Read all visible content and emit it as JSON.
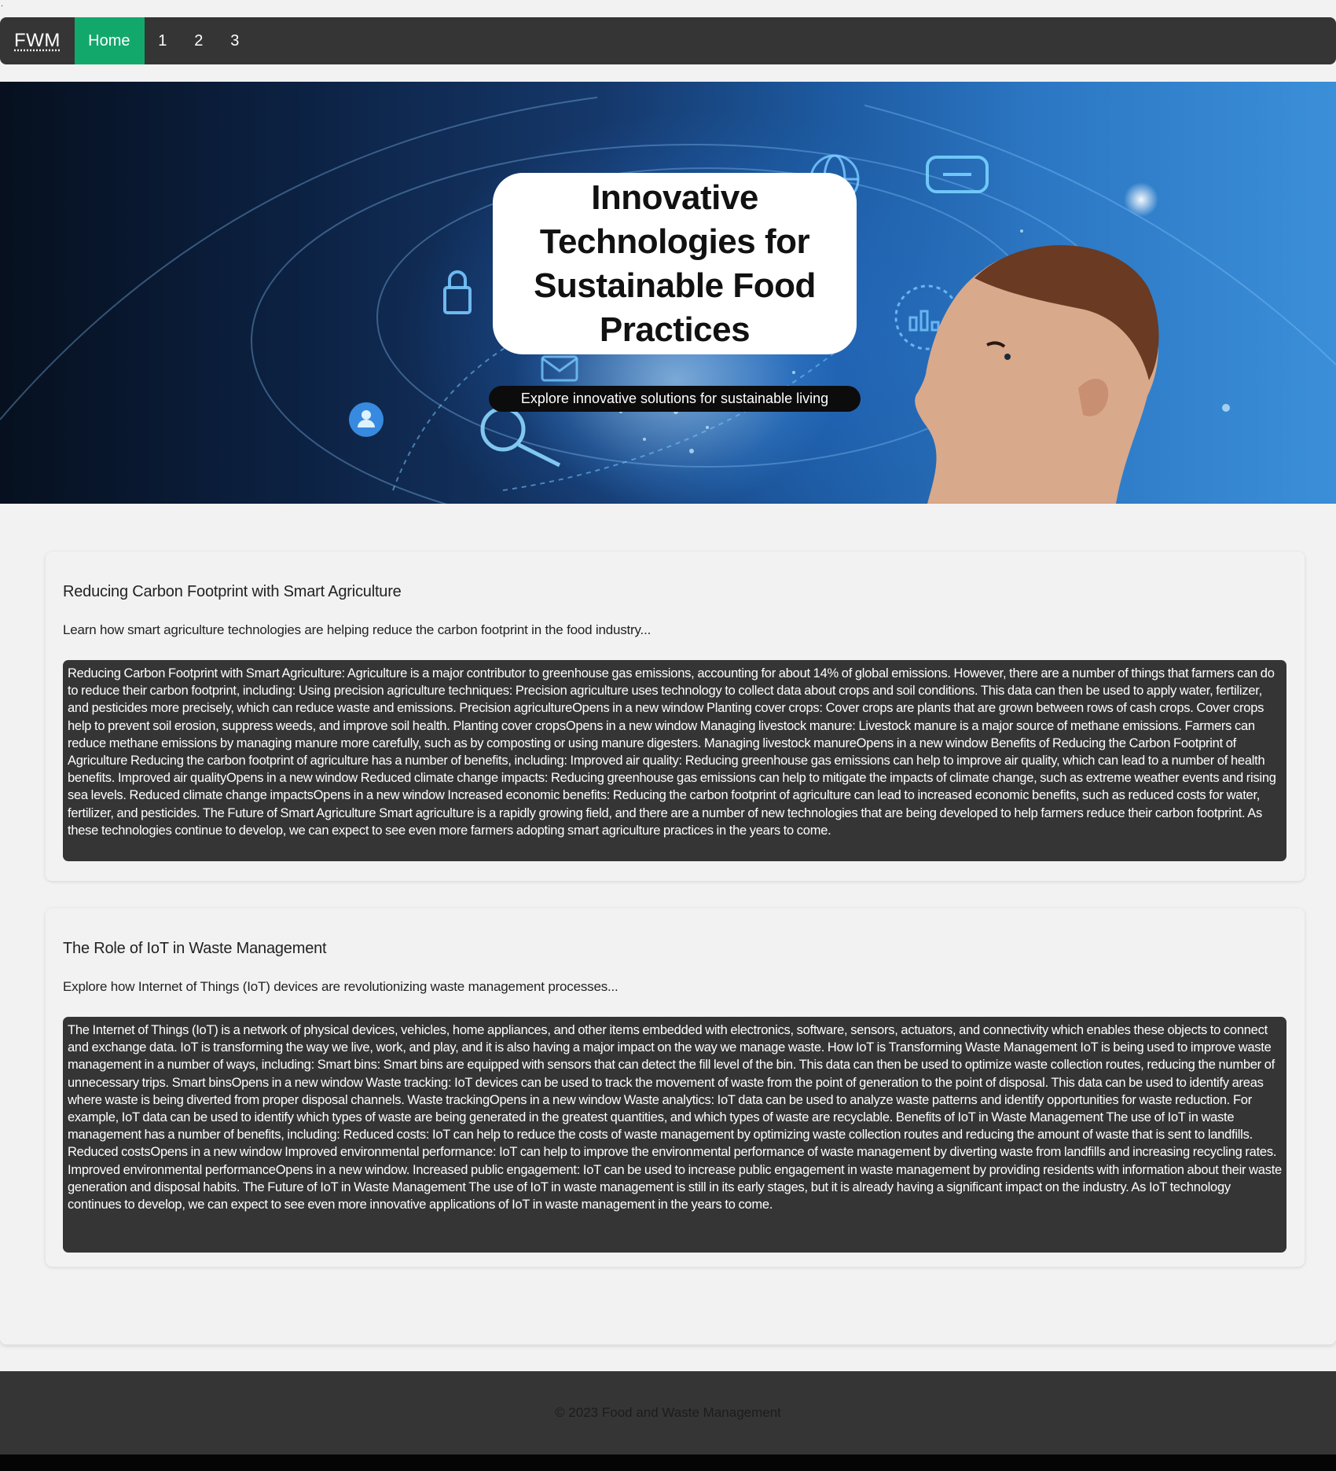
{
  "top_mark": ".",
  "nav": {
    "brand": "FWM",
    "items": [
      {
        "label": "Home"
      },
      {
        "label": "1"
      },
      {
        "label": "2"
      },
      {
        "label": "3"
      }
    ]
  },
  "hero": {
    "title": "Innovative Technologies for Sustainable Food Practices",
    "subtitle": "Explore innovative solutions for sustainable living"
  },
  "articles": [
    {
      "title": "Reducing Carbon Footprint with Smart Agriculture",
      "summary": "Learn how smart agriculture technologies are helping reduce the carbon footprint in the food industry...",
      "body": "Reducing Carbon Footprint with Smart Agriculture: Agriculture is a major contributor to greenhouse gas emissions, accounting for about 14% of global emissions. However, there are a number of things that farmers can do to reduce their carbon footprint, including: Using precision agriculture techniques: Precision agriculture uses technology to collect data about crops and soil conditions. This data can then be used to apply water, fertilizer, and pesticides more precisely, which can reduce waste and emissions. Precision agricultureOpens in a new window Planting cover crops: Cover crops are plants that are grown between rows of cash crops. Cover crops help to prevent soil erosion, suppress weeds, and improve soil health. Planting cover cropsOpens in a new window Managing livestock manure: Livestock manure is a major source of methane emissions. Farmers can reduce methane emissions by managing manure more carefully, such as by composting or using manure digesters. Managing livestock manureOpens in a new window Benefits of Reducing the Carbon Footprint of Agriculture Reducing the carbon footprint of agriculture has a number of benefits, including: Improved air quality: Reducing greenhouse gas emissions can help to improve air quality, which can lead to a number of health benefits. Improved air qualityOpens in a new window Reduced climate change impacts: Reducing greenhouse gas emissions can help to mitigate the impacts of climate change, such as extreme weather events and rising sea levels. Reduced climate change impactsOpens in a new window Increased economic benefits: Reducing the carbon footprint of agriculture can lead to increased economic benefits, such as reduced costs for water, fertilizer, and pesticides. The Future of Smart Agriculture Smart agriculture is a rapidly growing field, and there are a number of new technologies that are being developed to help farmers reduce their carbon footprint. As these technologies continue to develop, we can expect to see even more farmers adopting smart agriculture practices in the years to come."
    },
    {
      "title": "The Role of IoT in Waste Management",
      "summary": "Explore how Internet of Things (IoT) devices are revolutionizing waste management processes...",
      "body": "The Internet of Things (IoT) is a network of physical devices, vehicles, home appliances, and other items embedded with electronics, software, sensors, actuators, and connectivity which enables these objects to connect and exchange data. IoT is transforming the way we live, work, and play, and it is also having a major impact on the way we manage waste. How IoT is Transforming Waste Management IoT is being used to improve waste management in a number of ways, including: Smart bins: Smart bins are equipped with sensors that can detect the fill level of the bin. This data can then be used to optimize waste collection routes, reducing the number of unnecessary trips. Smart binsOpens in a new window Waste tracking: IoT devices can be used to track the movement of waste from the point of generation to the point of disposal. This data can be used to identify areas where waste is being diverted from proper disposal channels. Waste trackingOpens in a new window Waste analytics: IoT data can be used to analyze waste patterns and identify opportunities for waste reduction. For example, IoT data can be used to identify which types of waste are being generated in the greatest quantities, and which types of waste are recyclable. Benefits of IoT in Waste Management The use of IoT in waste management has a number of benefits, including: Reduced costs: IoT can help to reduce the costs of waste management by optimizing waste collection routes and reducing the amount of waste that is sent to landfills. Reduced costsOpens in a new window Improved environmental performance: IoT can help to improve the environmental performance of waste management by diverting waste from landfills and increasing recycling rates. Improved environmental performanceOpens in a new window. Increased public engagement: IoT can be used to increase public engagement in waste management by providing residents with information about their waste generation and disposal habits. The Future of IoT in Waste Management The use of IoT in waste management is still in its early stages, but it is already having a significant impact on the industry. As IoT technology continues to develop, we can expect to see even more innovative applications of IoT in waste management in the years to come."
    }
  ],
  "footer": {
    "text": "© 2023 Food and Waste Management"
  },
  "colors": {
    "nav_bg": "#353535",
    "nav_active": "#12a86c",
    "page_bg": "#f2f2f2",
    "body_block_bg": "#353535",
    "footer_bg": "#353535"
  }
}
